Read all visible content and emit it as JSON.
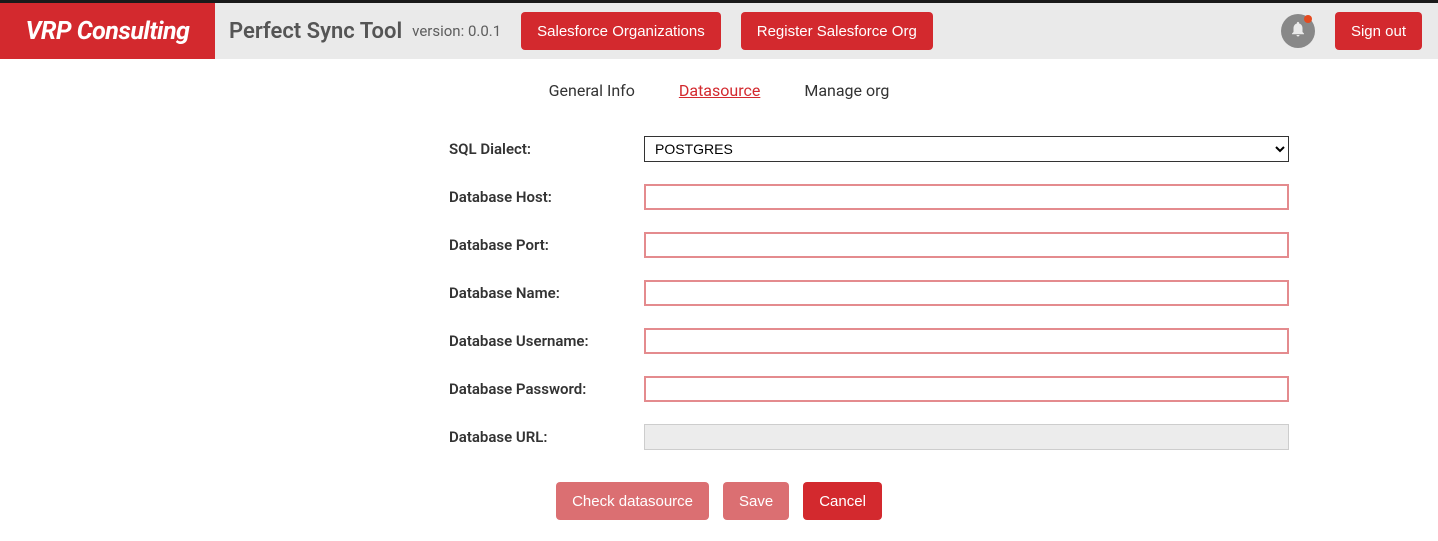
{
  "header": {
    "logo": "VRP Consulting",
    "app_title": "Perfect Sync Tool",
    "version": "version: 0.0.1",
    "btn_salesforce_orgs": "Salesforce Organizations",
    "btn_register_org": "Register Salesforce Org",
    "btn_signout": "Sign out"
  },
  "tabs": {
    "general": "General Info",
    "datasource": "Datasource",
    "manage": "Manage org"
  },
  "form": {
    "label_dialect": "SQL Dialect:",
    "value_dialect": "POSTGRES",
    "label_host": "Database Host:",
    "value_host": "",
    "label_port": "Database Port:",
    "value_port": "",
    "label_name": "Database Name:",
    "value_name": "",
    "label_username": "Database Username:",
    "value_username": "",
    "label_password": "Database Password:",
    "value_password": "",
    "label_url": "Database URL:",
    "value_url": ""
  },
  "actions": {
    "check": "Check datasource",
    "save": "Save",
    "cancel": "Cancel"
  }
}
